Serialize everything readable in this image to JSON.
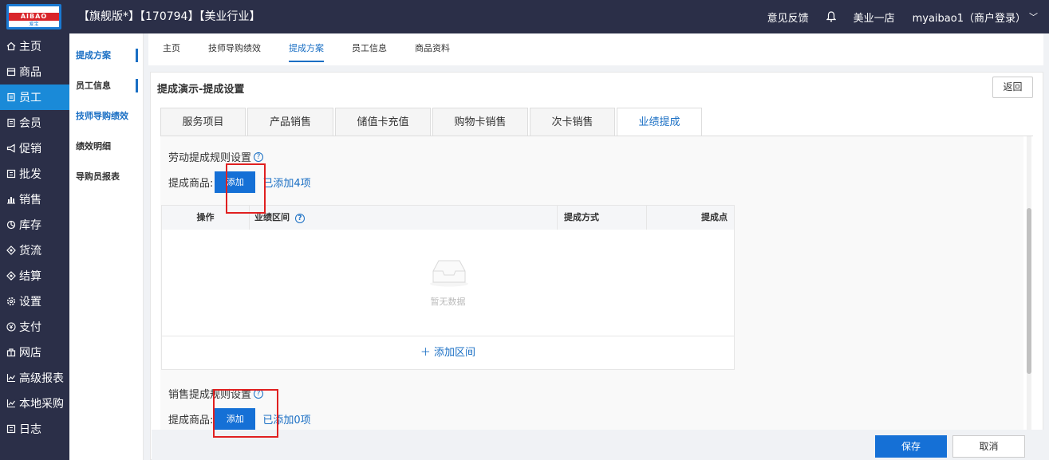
{
  "logo": {
    "text": "AIBAO",
    "sub": "爱宝"
  },
  "header": {
    "store_title": "【旗舰版*】【170794】【美业行业】",
    "feedback": "意见反馈",
    "store_name": "美业一店",
    "account": "myaibao1（商户登录）",
    "account_chevron": "﹀"
  },
  "sidebar": {
    "items": [
      {
        "label": "主页",
        "icon": "home-icon"
      },
      {
        "label": "商品",
        "icon": "goods-icon"
      },
      {
        "label": "员工",
        "icon": "staff-icon",
        "active": true
      },
      {
        "label": "会员",
        "icon": "member-icon"
      },
      {
        "label": "促销",
        "icon": "promotion-icon"
      },
      {
        "label": "批发",
        "icon": "wholesale-icon"
      },
      {
        "label": "销售",
        "icon": "sales-icon"
      },
      {
        "label": "库存",
        "icon": "inventory-icon"
      },
      {
        "label": "货流",
        "icon": "logistics-icon"
      },
      {
        "label": "结算",
        "icon": "settlement-icon"
      },
      {
        "label": "设置",
        "icon": "settings-icon"
      },
      {
        "label": "支付",
        "icon": "payment-icon"
      },
      {
        "label": "网店",
        "icon": "shop-icon"
      },
      {
        "label": "高级报表",
        "icon": "report-icon"
      },
      {
        "label": "本地采购",
        "icon": "purchase-icon"
      },
      {
        "label": "日志",
        "icon": "log-icon"
      }
    ]
  },
  "subsidebar": {
    "items": [
      {
        "label": "提成方案"
      },
      {
        "label": "员工信息"
      },
      {
        "label": "技师导购绩效"
      },
      {
        "label": "绩效明细"
      },
      {
        "label": "导购员报表"
      }
    ]
  },
  "top_tabs": [
    {
      "label": "主页"
    },
    {
      "label": "技师导购绩效"
    },
    {
      "label": "提成方案"
    },
    {
      "label": "员工信息"
    },
    {
      "label": "商品资料"
    }
  ],
  "panel": {
    "title": "提成演示-提成设置",
    "back_label": "返回"
  },
  "sub_tabs": [
    {
      "label": "服务项目"
    },
    {
      "label": "产品销售"
    },
    {
      "label": "储值卡充值"
    },
    {
      "label": "购物卡销售"
    },
    {
      "label": "次卡销售"
    },
    {
      "label": "业绩提成"
    }
  ],
  "labor_section": {
    "title": "劳动提成规则设置",
    "goods_label": "提成商品:",
    "add_label": "添加",
    "added_text": "已添加4项"
  },
  "table": {
    "headers": [
      "操作",
      "业绩区间",
      "提成方式",
      "提成点"
    ],
    "empty_text": "暂无数据",
    "add_range": "＋ 添加区间"
  },
  "sales_section": {
    "title": "销售提成规则设置",
    "goods_label": "提成商品:",
    "add_label": "添加",
    "added_text": "已添加0项"
  },
  "footer": {
    "save_label": "保存",
    "cancel_label": "取消"
  },
  "colors": {
    "nav_bg": "#2b2f48",
    "active_nav": "#1a8ad8",
    "primary": "#1570d6",
    "link": "#1a6fc4",
    "highlight_box": "#e02020"
  }
}
